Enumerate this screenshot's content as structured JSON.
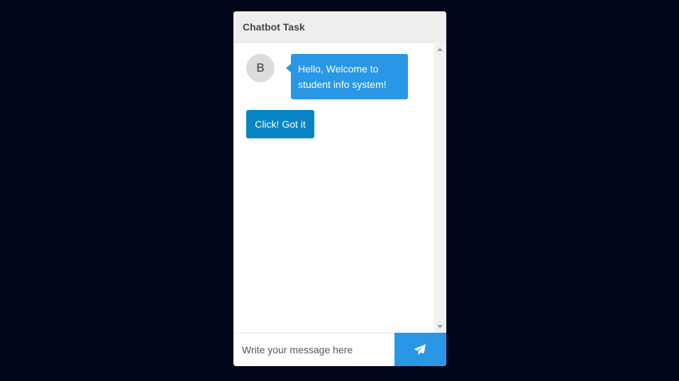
{
  "header": {
    "title": "Chatbot Task"
  },
  "messages": [
    {
      "avatar_letter": "B",
      "text": "Hello, Welcome to student info system!"
    }
  ],
  "quick_reply": {
    "label": "Click! Got it"
  },
  "composer": {
    "placeholder": "Write your message here",
    "send_icon": "paper-plane-icon"
  },
  "colors": {
    "background": "#02061a",
    "header": "#eeeeee",
    "bubble": "#2997e6",
    "quick_reply": "#0784c4",
    "send_button": "#2997e6"
  }
}
